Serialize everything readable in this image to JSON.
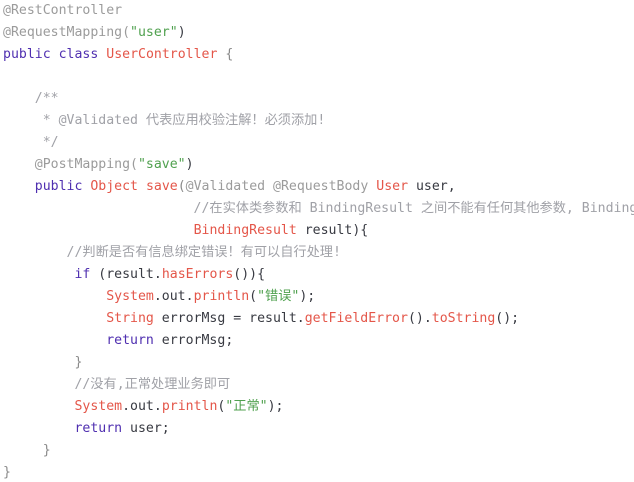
{
  "code": {
    "lines": [
      [
        {
          "t": "@RestController",
          "c": "ann"
        }
      ],
      [
        {
          "t": "@RequestMapping(",
          "c": "ann"
        },
        {
          "t": "\"user\"",
          "c": "str"
        },
        {
          "t": ")",
          "c": "pl"
        }
      ],
      [
        {
          "t": "public",
          "c": "kw"
        },
        {
          "t": " ",
          "c": "pl"
        },
        {
          "t": "class",
          "c": "kw"
        },
        {
          "t": " ",
          "c": "pl"
        },
        {
          "t": "UserController",
          "c": "typ"
        },
        {
          "t": " {",
          "c": "dim"
        }
      ],
      [],
      [
        {
          "t": "    /**",
          "c": "cmt"
        }
      ],
      [
        {
          "t": "     * @Validated 代表应用校验注解！必须添加!",
          "c": "cmt"
        }
      ],
      [
        {
          "t": "     */",
          "c": "cmt"
        }
      ],
      [
        {
          "t": "    @PostMapping(",
          "c": "ann"
        },
        {
          "t": "\"save\"",
          "c": "str"
        },
        {
          "t": ")",
          "c": "pl"
        }
      ],
      [
        {
          "t": "    ",
          "c": "pl"
        },
        {
          "t": "public",
          "c": "kw"
        },
        {
          "t": " ",
          "c": "pl"
        },
        {
          "t": "Object",
          "c": "typ"
        },
        {
          "t": " ",
          "c": "pl"
        },
        {
          "t": "save",
          "c": "fn"
        },
        {
          "t": "(",
          "c": "dim"
        },
        {
          "t": "@Validated @RequestBody",
          "c": "ann"
        },
        {
          "t": " ",
          "c": "pl"
        },
        {
          "t": "User",
          "c": "typ"
        },
        {
          "t": " user,",
          "c": "pl"
        }
      ],
      [
        {
          "t": "                        //在实体类参数和 BindingResult 之间不能有任何其他参数, BindingResult",
          "c": "cmt"
        }
      ],
      [
        {
          "t": "                        ",
          "c": "pl"
        },
        {
          "t": "BindingResult",
          "c": "typ"
        },
        {
          "t": " result){",
          "c": "pl"
        }
      ],
      [
        {
          "t": "        //判断是否有信息绑定错误！有可以自行处理!",
          "c": "cmt"
        }
      ],
      [
        {
          "t": "         ",
          "c": "pl"
        },
        {
          "t": "if",
          "c": "kw"
        },
        {
          "t": " (result.",
          "c": "pl"
        },
        {
          "t": "hasErrors",
          "c": "fn"
        },
        {
          "t": "()){",
          "c": "pl"
        }
      ],
      [
        {
          "t": "             ",
          "c": "pl"
        },
        {
          "t": "System",
          "c": "typ"
        },
        {
          "t": ".out.",
          "c": "pl"
        },
        {
          "t": "println",
          "c": "fn"
        },
        {
          "t": "(",
          "c": "pl"
        },
        {
          "t": "\"错误\"",
          "c": "str"
        },
        {
          "t": ");",
          "c": "pl"
        }
      ],
      [
        {
          "t": "             ",
          "c": "pl"
        },
        {
          "t": "String",
          "c": "typ"
        },
        {
          "t": " errorMsg = result.",
          "c": "pl"
        },
        {
          "t": "getFieldError",
          "c": "fn"
        },
        {
          "t": "().",
          "c": "pl"
        },
        {
          "t": "toString",
          "c": "fn"
        },
        {
          "t": "();",
          "c": "pl"
        }
      ],
      [
        {
          "t": "             ",
          "c": "pl"
        },
        {
          "t": "return",
          "c": "kw"
        },
        {
          "t": " errorMsg;",
          "c": "pl"
        }
      ],
      [
        {
          "t": "         }",
          "c": "dim"
        }
      ],
      [
        {
          "t": "         //没有,正常处理业务即可",
          "c": "cmt"
        }
      ],
      [
        {
          "t": "         ",
          "c": "pl"
        },
        {
          "t": "System",
          "c": "typ"
        },
        {
          "t": ".out.",
          "c": "pl"
        },
        {
          "t": "println",
          "c": "fn"
        },
        {
          "t": "(",
          "c": "pl"
        },
        {
          "t": "\"正常\"",
          "c": "str"
        },
        {
          "t": ");",
          "c": "pl"
        }
      ],
      [
        {
          "t": "         ",
          "c": "pl"
        },
        {
          "t": "return",
          "c": "kw"
        },
        {
          "t": " user;",
          "c": "pl"
        }
      ],
      [
        {
          "t": "     }",
          "c": "dim"
        }
      ],
      [
        {
          "t": "}",
          "c": "dim"
        }
      ]
    ]
  }
}
